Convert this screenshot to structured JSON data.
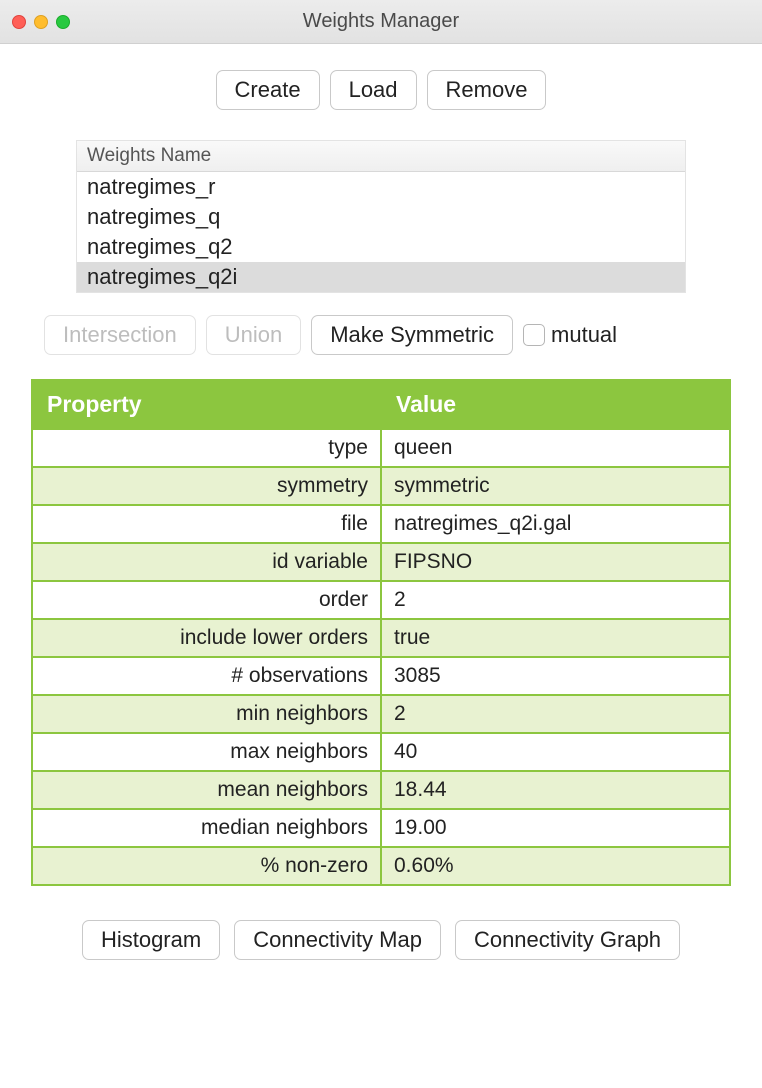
{
  "window": {
    "title": "Weights Manager"
  },
  "top_buttons": {
    "create": "Create",
    "load": "Load",
    "remove": "Remove"
  },
  "weights_list": {
    "header": "Weights Name",
    "items": [
      {
        "name": "natregimes_r",
        "selected": false
      },
      {
        "name": "natregimes_q",
        "selected": false
      },
      {
        "name": "natregimes_q2",
        "selected": false
      },
      {
        "name": "natregimes_q2i",
        "selected": true
      }
    ]
  },
  "ops": {
    "intersection": "Intersection",
    "union": "Union",
    "make_symmetric": "Make Symmetric",
    "mutual_label": "mutual"
  },
  "properties": {
    "headers": {
      "property": "Property",
      "value": "Value"
    },
    "rows": [
      {
        "key": "type",
        "value": "queen"
      },
      {
        "key": "symmetry",
        "value": "symmetric"
      },
      {
        "key": "file",
        "value": "natregimes_q2i.gal"
      },
      {
        "key": "id variable",
        "value": "FIPSNO"
      },
      {
        "key": "order",
        "value": "2"
      },
      {
        "key": "include lower orders",
        "value": "true"
      },
      {
        "key": "# observations",
        "value": "3085"
      },
      {
        "key": "min neighbors",
        "value": "2"
      },
      {
        "key": "max neighbors",
        "value": "40"
      },
      {
        "key": "mean neighbors",
        "value": "18.44"
      },
      {
        "key": "median neighbors",
        "value": "19.00"
      },
      {
        "key": "% non-zero",
        "value": "0.60%"
      }
    ]
  },
  "bottom_buttons": {
    "histogram": "Histogram",
    "conn_map": "Connectivity Map",
    "conn_graph": "Connectivity Graph"
  }
}
